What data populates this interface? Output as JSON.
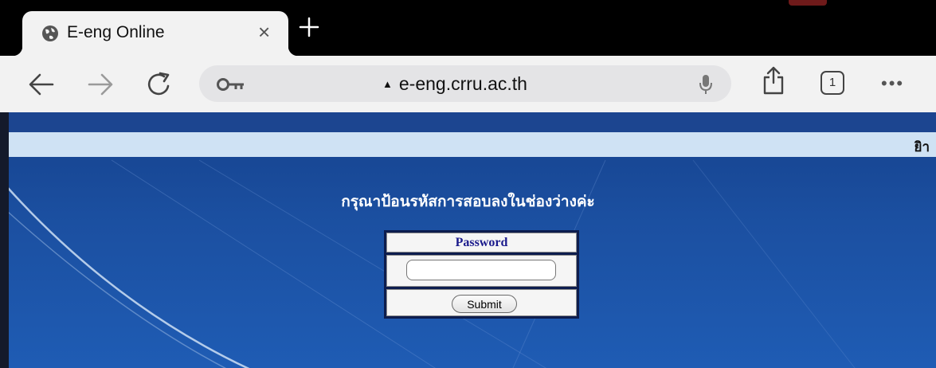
{
  "browser": {
    "tab": {
      "title": "E-eng Online",
      "icon": "globe-icon",
      "close": "×"
    },
    "new_tab_icon": "plus-icon",
    "toolbar": {
      "back_icon": "back-arrow-icon",
      "forward_icon": "forward-arrow-icon",
      "reload_icon": "reload-icon",
      "url": "e-eng.crru.ac.th",
      "url_warning": "▲",
      "tab_count": "1",
      "more": "•••"
    }
  },
  "page": {
    "band_text": "ยิา",
    "prompt": "กรุณาป้อนรหัสการสอบลงในช่องว่างค่ะ",
    "password_label": "Password",
    "password_value": "",
    "submit_label": "Submit"
  },
  "colors": {
    "page_background": "#1b4fa0",
    "band": "#cfe2f4",
    "label": "#1a1a8c"
  }
}
